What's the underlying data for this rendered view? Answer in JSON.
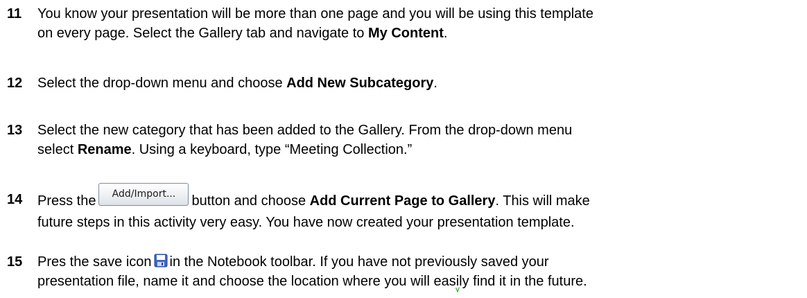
{
  "steps": [
    {
      "number": "11",
      "line1": "You know your presentation will be more than one page and you will be using this template",
      "line2_a": "on every page. Select the Gallery tab and navigate to ",
      "line2_b": "My Content",
      "line2_c": "."
    },
    {
      "number": "12",
      "a": "Select the drop-down menu and choose ",
      "b": "Add New Subcategory",
      "c": "."
    },
    {
      "number": "13",
      "line1": "Select the new category that has been added to the Gallery. From the drop-down menu",
      "line2_a": "select ",
      "line2_b": "Rename",
      "line2_c": ". Using a keyboard, type “Meeting Collection.”"
    },
    {
      "number": "14",
      "a": "Press the",
      "button_label": "Add/Import...",
      "b": "button and choose ",
      "c": "Add Current Page to Gallery",
      "d": ".  This will make",
      "line2": "future steps in this activity very easy. You have now created your presentation template."
    },
    {
      "number": "15",
      "a": "Pres the save icon",
      "b": "in the Notebook toolbar. If you have not previously saved your",
      "line2": "presentation file, name it and choose the location where you will easily find it in the future."
    }
  ],
  "icons": {
    "save": "save-icon"
  }
}
